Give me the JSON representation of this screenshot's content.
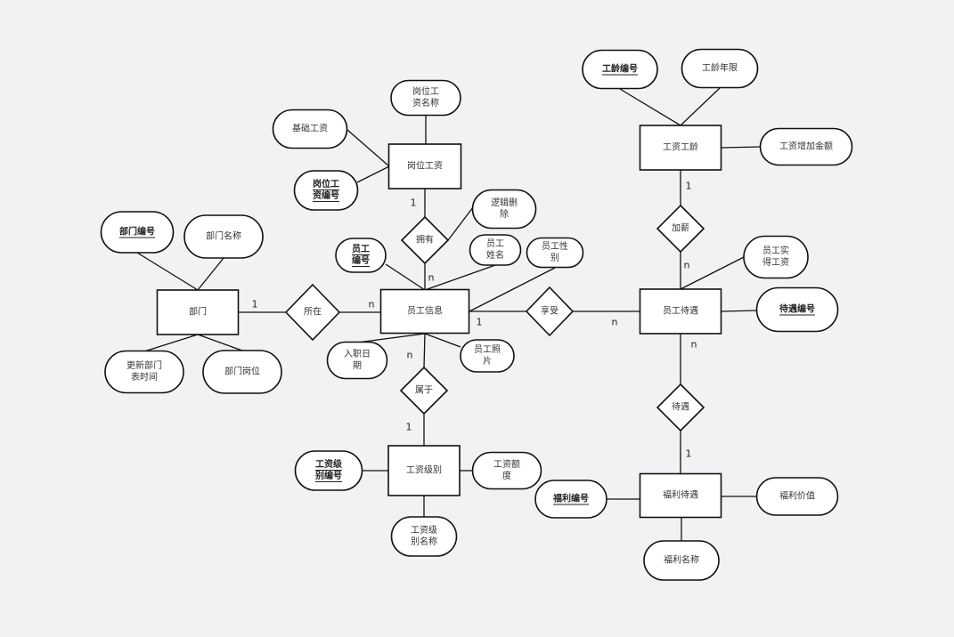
{
  "diagram": {
    "type": "er-diagram",
    "entities": [
      {
        "id": "dept",
        "label": [
          "部门"
        ]
      },
      {
        "id": "emp",
        "label": [
          "员工信息"
        ]
      },
      {
        "id": "postpay",
        "label": [
          "岗位工资"
        ]
      },
      {
        "id": "level",
        "label": [
          "工资级别"
        ]
      },
      {
        "id": "seniority",
        "label": [
          "工资工龄"
        ]
      },
      {
        "id": "treat",
        "label": [
          "员工待遇"
        ]
      },
      {
        "id": "welfare",
        "label": [
          "福利待遇"
        ]
      }
    ],
    "relationships": [
      {
        "id": "r_in",
        "label": [
          "所在"
        ]
      },
      {
        "id": "r_has",
        "label": [
          "拥有"
        ]
      },
      {
        "id": "r_enjoy",
        "label": [
          "享受"
        ]
      },
      {
        "id": "r_belong",
        "label": [
          "属于"
        ]
      },
      {
        "id": "r_raise",
        "label": [
          "加薪"
        ]
      },
      {
        "id": "r_treat",
        "label": [
          "待遇"
        ]
      }
    ],
    "attributes": [
      {
        "id": "a1",
        "label": [
          "部门编号"
        ],
        "key": true
      },
      {
        "id": "a2",
        "label": [
          "部门名称"
        ],
        "key": false
      },
      {
        "id": "a3",
        "label": [
          "更新部门",
          "表时间"
        ],
        "key": false
      },
      {
        "id": "a4",
        "label": [
          "部门岗位"
        ],
        "key": false
      },
      {
        "id": "a5",
        "label": [
          "岗位工",
          "资名称"
        ],
        "key": false
      },
      {
        "id": "a6",
        "label": [
          "基础工资"
        ],
        "key": false
      },
      {
        "id": "a7",
        "label": [
          "岗位工",
          "资编号"
        ],
        "key": true
      },
      {
        "id": "a8",
        "label": [
          "逻辑删",
          "除"
        ],
        "key": false
      },
      {
        "id": "a9",
        "label": [
          "员工",
          "编号"
        ],
        "key": true
      },
      {
        "id": "a10",
        "label": [
          "员工",
          "姓名"
        ],
        "key": false
      },
      {
        "id": "a11",
        "label": [
          "员工性",
          "别"
        ],
        "key": false
      },
      {
        "id": "a12",
        "label": [
          "入职日",
          "期"
        ],
        "key": false
      },
      {
        "id": "a13",
        "label": [
          "员工照",
          "片"
        ],
        "key": false
      },
      {
        "id": "a14",
        "label": [
          "工龄编号"
        ],
        "key": true
      },
      {
        "id": "a15",
        "label": [
          "工龄年限"
        ],
        "key": false
      },
      {
        "id": "a16",
        "label": [
          "工资增加金额"
        ],
        "key": false
      },
      {
        "id": "a17",
        "label": [
          "员工实",
          "得工资"
        ],
        "key": false
      },
      {
        "id": "a18",
        "label": [
          "待遇编号"
        ],
        "key": true
      },
      {
        "id": "a19",
        "label": [
          "工资级",
          "别编号"
        ],
        "key": true
      },
      {
        "id": "a20",
        "label": [
          "工资额",
          "度"
        ],
        "key": false
      },
      {
        "id": "a21",
        "label": [
          "工资级",
          "别名称"
        ],
        "key": false
      },
      {
        "id": "a22",
        "label": [
          "福利编号"
        ],
        "key": true
      },
      {
        "id": "a23",
        "label": [
          "福利价值"
        ],
        "key": false
      },
      {
        "id": "a24",
        "label": [
          "福利名称"
        ],
        "key": false
      }
    ],
    "cardinalities": [
      "1",
      "n",
      "1",
      "n",
      "1",
      "n",
      "n",
      "1",
      "1",
      "n",
      "n",
      "1"
    ]
  }
}
